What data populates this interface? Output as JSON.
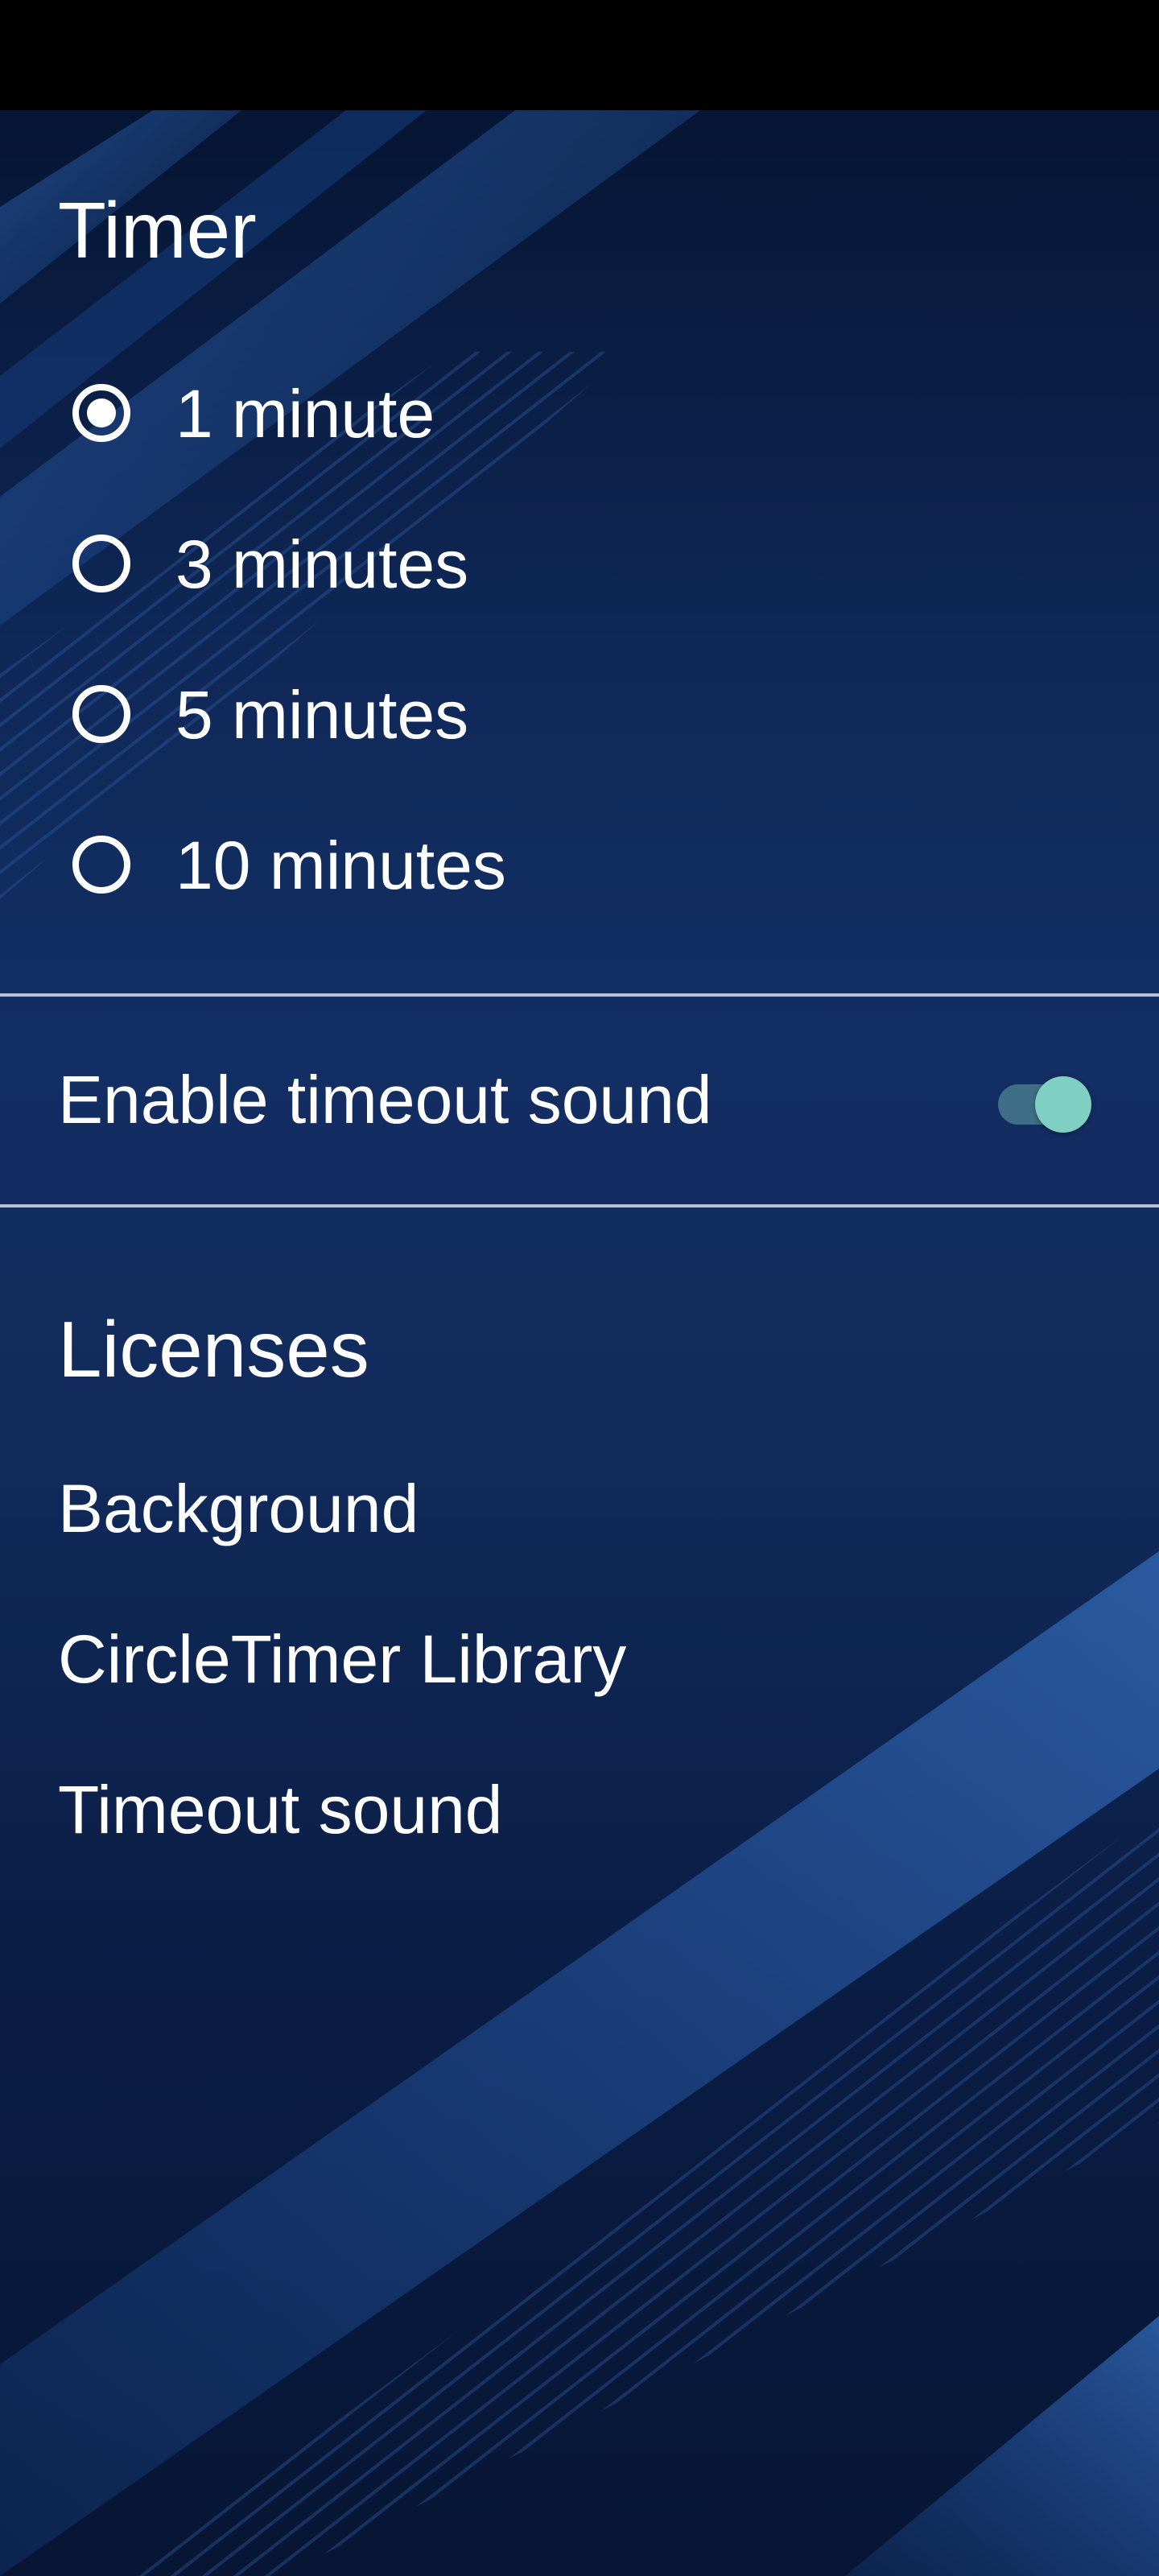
{
  "timer": {
    "title": "Timer",
    "options": [
      {
        "label": "1 minute",
        "selected": true
      },
      {
        "label": "3 minutes",
        "selected": false
      },
      {
        "label": "5 minutes",
        "selected": false
      },
      {
        "label": "10 minutes",
        "selected": false
      }
    ]
  },
  "sound": {
    "label": "Enable timeout sound",
    "enabled": true
  },
  "licenses": {
    "title": "Licenses",
    "items": [
      "Background",
      "CircleTimer Library",
      "Timeout sound"
    ]
  },
  "colors": {
    "accent": "#7fcfc2",
    "background": "#0f2858",
    "status_bar": "#000000"
  }
}
